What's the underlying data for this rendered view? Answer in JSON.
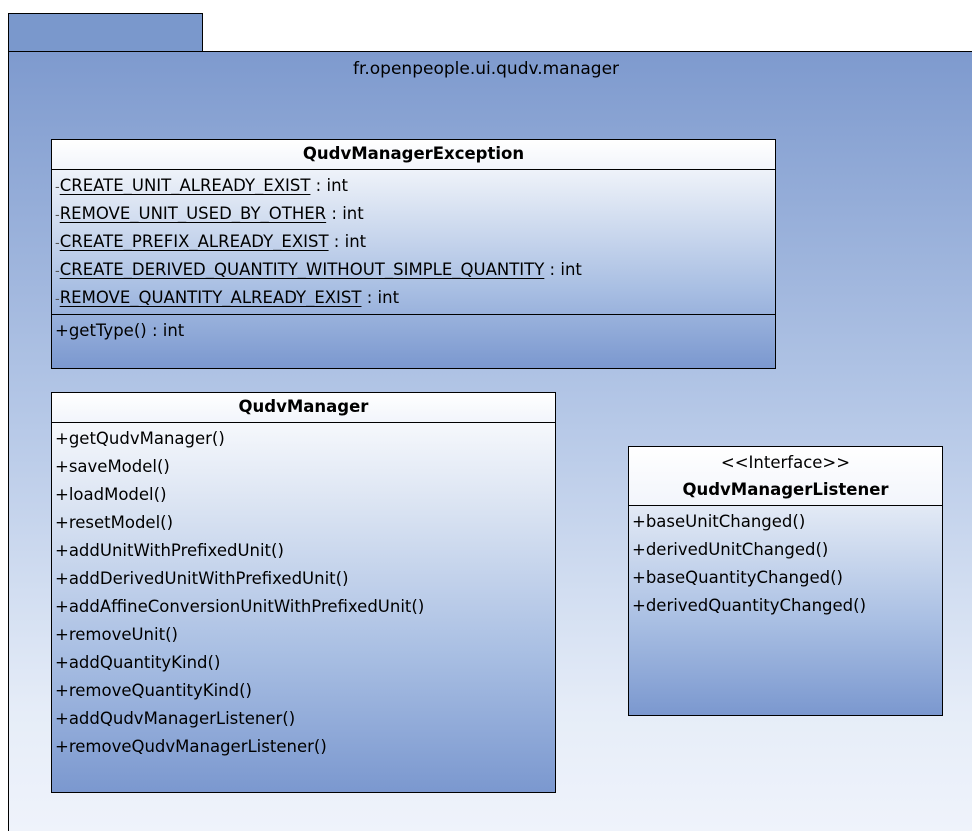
{
  "package": {
    "name": "fr.openpeople.ui.qudv.manager"
  },
  "classes": {
    "exception": {
      "name": "QudvManagerException",
      "attributes": [
        {
          "vis": "-",
          "name": "CREATE_UNIT_ALREADY_EXIST",
          "type": " : int"
        },
        {
          "vis": "-",
          "name": "REMOVE_UNIT_USED_BY_OTHER",
          "type": " : int"
        },
        {
          "vis": "-",
          "name": "CREATE_PREFIX_ALREADY_EXIST",
          "type": " : int"
        },
        {
          "vis": "-",
          "name": "CREATE_DERIVED_QUANTITY_WITHOUT_SIMPLE_QUANTITY",
          "type": " : int"
        },
        {
          "vis": "-",
          "name": "REMOVE_QUANTITY_ALREADY_EXIST",
          "type": " : int"
        }
      ],
      "operations": [
        "+getType() : int"
      ]
    },
    "manager": {
      "name": "QudvManager",
      "operations": [
        "+getQudvManager()",
        "+saveModel()",
        "+loadModel()",
        "+resetModel()",
        "+addUnitWithPrefixedUnit()",
        "+addDerivedUnitWithPrefixedUnit()",
        "+addAffineConversionUnitWithPrefixedUnit()",
        "+removeUnit()",
        "+addQuantityKind()",
        "+removeQuantityKind()",
        "+addQudvManagerListener()",
        "+removeQudvManagerListener()"
      ]
    },
    "listener": {
      "stereotype": "<<Interface>>",
      "name": "QudvManagerListener",
      "operations": [
        "+baseUnitChanged()",
        "+derivedUnitChanged()",
        "+baseQuantityChanged()",
        "+derivedQuantityChanged()"
      ]
    }
  }
}
